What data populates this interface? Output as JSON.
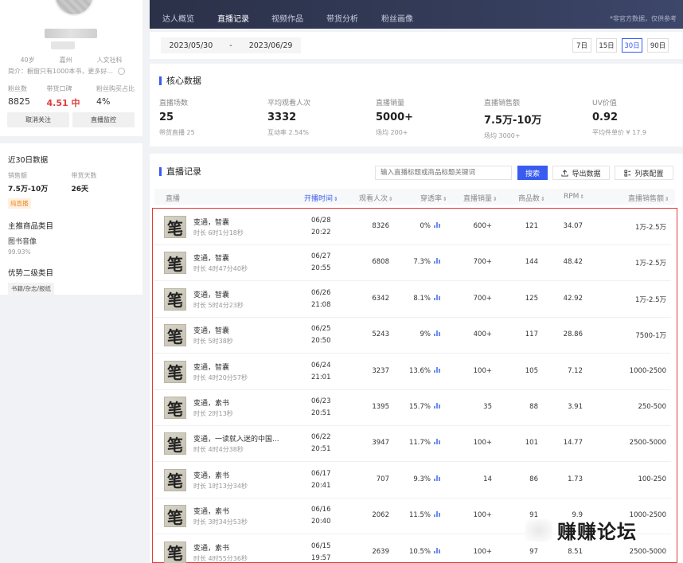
{
  "profile": {
    "age": "40岁",
    "city": "嘉州",
    "category": "人文社科",
    "bio": "简介：橱窗只有1000本书，更多好...",
    "stats": [
      {
        "label": "粉丝数",
        "value": "8825"
      },
      {
        "label": "带货口碑",
        "value": "4.51 中"
      },
      {
        "label": "粉丝购买占比",
        "value": "4%"
      }
    ],
    "unfollow_label": "取消关注",
    "monitor_label": "直播监控"
  },
  "summary30": {
    "title": "近30日数据",
    "sales_label": "销售额",
    "sales_value": "7.5万-10万",
    "days_label": "带货天数",
    "days_value": "26天",
    "tag": "纯直播",
    "main_cat_title": "主推商品类目",
    "main_cat": "图书音像",
    "main_cat_pct": "99.93%",
    "sub_cat_title": "优势二级类目",
    "sub_cat": "书籍/杂志/报纸"
  },
  "topnav": {
    "tabs": [
      "达人概览",
      "直播记录",
      "视频作品",
      "带货分析",
      "粉丝画像"
    ],
    "active": "直播记录",
    "note": "*非官方数据，仅供参考"
  },
  "datebar": {
    "start": "2023/05/30",
    "sep": "-",
    "end": "2023/06/29",
    "ranges": [
      "7日",
      "15日",
      "30日",
      "90日"
    ],
    "active_range": "30日"
  },
  "core": {
    "title": "核心数据",
    "metrics": [
      {
        "label": "直播场数",
        "value": "25",
        "sub": "带货直播 25"
      },
      {
        "label": "平均观看人次",
        "value": "3332",
        "sub": "互动率 2.54%"
      },
      {
        "label": "直播销量",
        "value": "5000+",
        "sub": "场均 200+"
      },
      {
        "label": "直播销售额",
        "value": "7.5万-10万",
        "sub": "场均 3000+"
      },
      {
        "label": "UV价值",
        "value": "0.92",
        "sub": "平均件单价 ¥ 17.9"
      }
    ]
  },
  "records": {
    "title": "直播记录",
    "search_placeholder": "输入直播标题或商品标题关键词",
    "search_label": "搜索",
    "export_label": "导出数据",
    "config_label": "列表配置",
    "columns": [
      "直播",
      "开播时间",
      "观看人次",
      "穿透率",
      "直播销量",
      "商品数",
      "RPM",
      "直播销售额"
    ],
    "sort_icon": "⇕",
    "thumb_char": "笔",
    "rows": [
      {
        "title": "变通，智囊",
        "duration": "时长 6时1分18秒",
        "date": "06/28",
        "time": "20:22",
        "views": "8326",
        "rate": "0%",
        "sales": "600+",
        "items": "121",
        "rpm": "34.07",
        "gmv": "1万-2.5万"
      },
      {
        "title": "变通，智囊",
        "duration": "时长 4时47分40秒",
        "date": "06/27",
        "time": "20:55",
        "views": "6808",
        "rate": "7.3%",
        "sales": "700+",
        "items": "144",
        "rpm": "48.42",
        "gmv": "1万-2.5万"
      },
      {
        "title": "变通，智囊",
        "duration": "时长 5时4分23秒",
        "date": "06/26",
        "time": "21:08",
        "views": "6342",
        "rate": "8.1%",
        "sales": "700+",
        "items": "125",
        "rpm": "42.92",
        "gmv": "1万-2.5万"
      },
      {
        "title": "变通，智囊",
        "duration": "时长 5时38秒",
        "date": "06/25",
        "time": "20:50",
        "views": "5243",
        "rate": "9%",
        "sales": "400+",
        "items": "117",
        "rpm": "28.86",
        "gmv": "7500-1万"
      },
      {
        "title": "变通，智囊",
        "duration": "时长 4时20分57秒",
        "date": "06/24",
        "time": "21:01",
        "views": "3237",
        "rate": "13.6%",
        "sales": "100+",
        "items": "105",
        "rpm": "7.12",
        "gmv": "1000-2500"
      },
      {
        "title": "变通，素书",
        "duration": "时长 2时13秒",
        "date": "06/23",
        "time": "20:51",
        "views": "1395",
        "rate": "15.7%",
        "sales": "35",
        "items": "88",
        "rpm": "3.91",
        "gmv": "250-500"
      },
      {
        "title": "变通，一读就入迷的中国...",
        "duration": "时长 4时4分38秒",
        "date": "06/22",
        "time": "20:51",
        "views": "3947",
        "rate": "11.7%",
        "sales": "100+",
        "items": "101",
        "rpm": "14.77",
        "gmv": "2500-5000"
      },
      {
        "title": "变通，素书",
        "duration": "时长 1时13分34秒",
        "date": "06/17",
        "time": "20:41",
        "views": "707",
        "rate": "9.3%",
        "sales": "14",
        "items": "86",
        "rpm": "1.73",
        "gmv": "100-250"
      },
      {
        "title": "变通，素书",
        "duration": "时长 3时34分53秒",
        "date": "06/16",
        "time": "20:40",
        "views": "2062",
        "rate": "11.5%",
        "sales": "100+",
        "items": "91",
        "rpm": "9.9",
        "gmv": "1000-2500"
      },
      {
        "title": "变通，素书",
        "duration": "时长 4时55分36秒",
        "date": "06/15",
        "time": "19:57",
        "views": "2639",
        "rate": "10.5%",
        "sales": "100+",
        "items": "97",
        "rpm": "8.51",
        "gmv": "2500-5000"
      }
    ]
  },
  "watermark": "赚赚论坛",
  "colors": {
    "accent": "#3a5bf0",
    "highlight_box": "#e23a3a",
    "danger": "#e03c3c",
    "nav_bg": "#2b3148"
  }
}
